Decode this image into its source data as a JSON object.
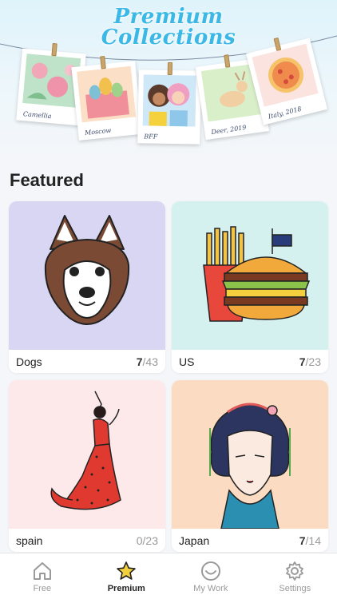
{
  "banner": {
    "title_line1": "Premium",
    "title_line2": "Collections",
    "photos": [
      {
        "caption": "Camellia"
      },
      {
        "caption": "Moscow"
      },
      {
        "caption": "BFF"
      },
      {
        "caption": "Deer, 2019"
      },
      {
        "caption": "Italy, 2018"
      }
    ]
  },
  "featured": {
    "title": "Featured",
    "cards": [
      {
        "name": "Dogs",
        "done": "7",
        "total": "/43",
        "bg": "#d9d6f4"
      },
      {
        "name": "US",
        "done": "7",
        "total": "/23",
        "bg": "#d4f1f0"
      },
      {
        "name": "spain",
        "done": "0",
        "total": "/23",
        "bg": "#fde9ea"
      },
      {
        "name": "Japan",
        "done": "7",
        "total": "/14",
        "bg": "#fbdcc2"
      }
    ]
  },
  "tabs": [
    {
      "label": "Free",
      "icon": "home-icon"
    },
    {
      "label": "Premium",
      "icon": "star-icon"
    },
    {
      "label": "My Work",
      "icon": "smiley-icon"
    },
    {
      "label": "Settings",
      "icon": "gear-icon"
    }
  ],
  "colors": {
    "accent": "#3bb8e6",
    "star": "#f3cf3c"
  }
}
